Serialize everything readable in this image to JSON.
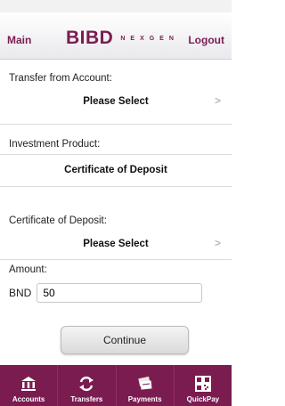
{
  "header": {
    "main_label": "Main",
    "logo_main": "BIBD",
    "logo_sub": "NEXGEN",
    "logout_label": "Logout"
  },
  "form": {
    "transfer_from": {
      "label": "Transfer from Account:",
      "value": "Please Select"
    },
    "investment_product": {
      "label": "Investment Product:",
      "value": "Certificate of Deposit"
    },
    "certificate": {
      "label": "Certificate of Deposit:",
      "value": "Please Select"
    },
    "amount": {
      "label": "Amount:",
      "currency": "BND",
      "value": "50"
    },
    "continue_label": "Continue"
  },
  "tabbar": {
    "items": [
      {
        "label": "Accounts",
        "icon": "bank-icon"
      },
      {
        "label": "Transfers",
        "icon": "transfer-arrows-icon"
      },
      {
        "label": "Payments",
        "icon": "bills-icon"
      },
      {
        "label": "QuickPay",
        "icon": "qr-code-icon"
      }
    ]
  },
  "colors": {
    "brand": "#7b1c50",
    "tabbar": "#7b1c50"
  }
}
